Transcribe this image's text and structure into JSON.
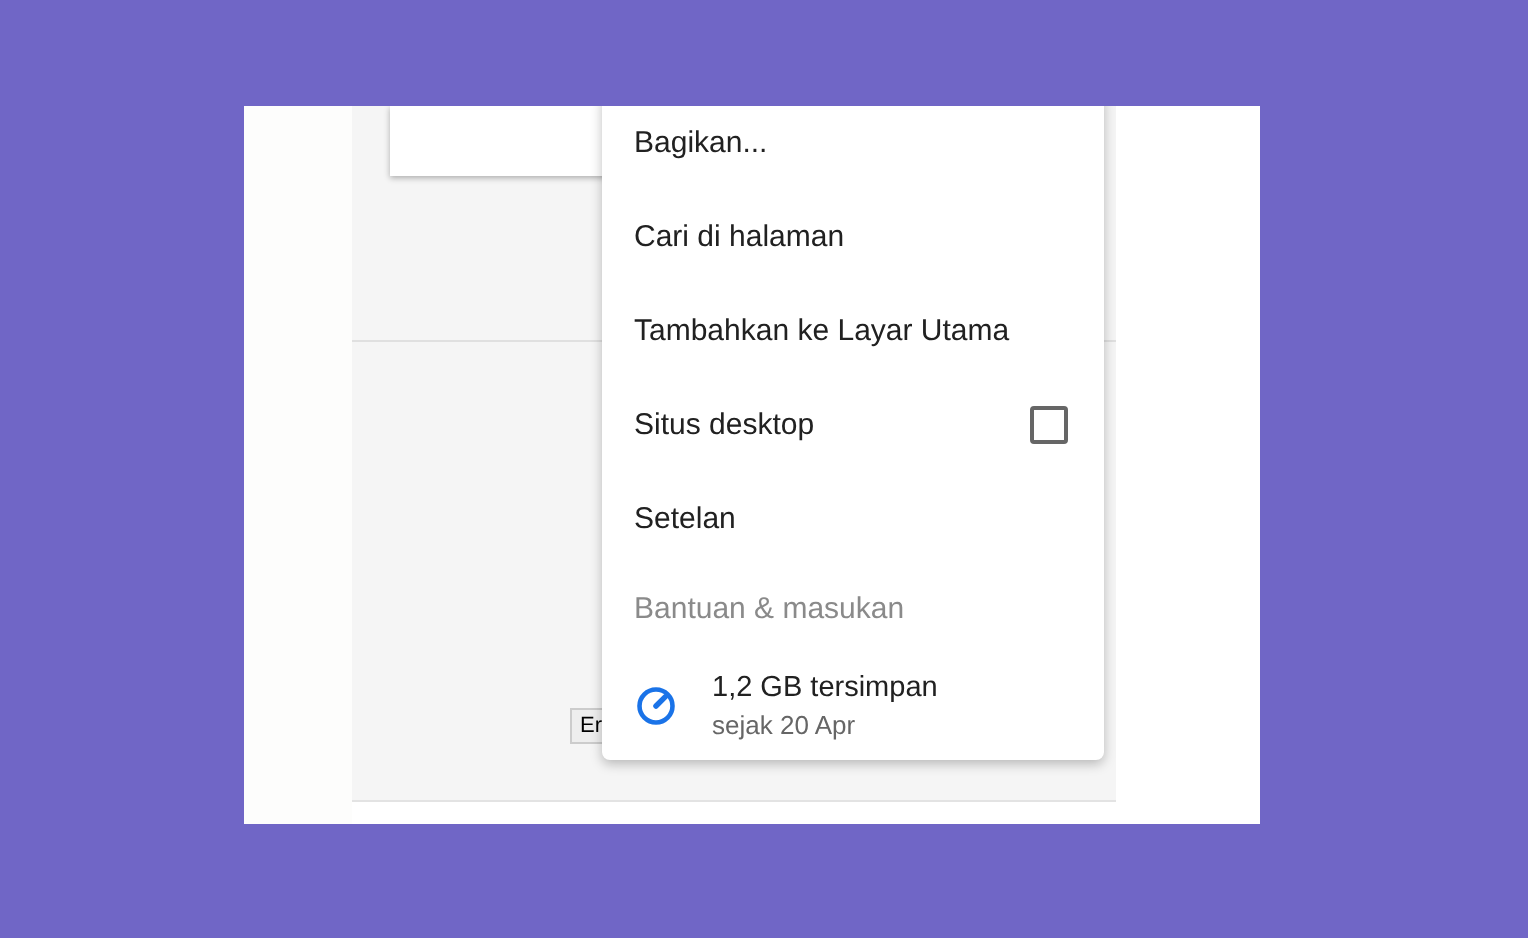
{
  "page": {
    "button_label": "Er"
  },
  "menu": {
    "items": [
      {
        "label": "Bagikan...",
        "kind": "plain",
        "dimmed": false
      },
      {
        "label": "Cari di halaman",
        "kind": "plain",
        "dimmed": false
      },
      {
        "label": "Tambahkan ke Layar Utama",
        "kind": "plain",
        "dimmed": false
      },
      {
        "label": "Situs desktop",
        "kind": "checkbox",
        "checked": false,
        "dimmed": false
      },
      {
        "label": "Setelan",
        "kind": "plain",
        "dimmed": false
      },
      {
        "label": "Bantuan & masukan",
        "kind": "plain",
        "dimmed": true
      }
    ],
    "storage": {
      "amount": "1,2 GB tersimpan",
      "since": "sejak 20 Apr"
    }
  }
}
